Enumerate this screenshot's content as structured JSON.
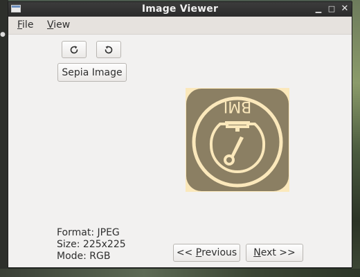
{
  "window": {
    "title": "Image Viewer"
  },
  "menu": {
    "file": {
      "mnemonic": "F",
      "rest": "ile"
    },
    "view": {
      "mnemonic": "V",
      "rest": "iew"
    }
  },
  "toolbar": {
    "sepia_label": "Sepia Image"
  },
  "image": {
    "logo_text": "BMI",
    "bg_color": "#8b7f63",
    "fg_color": "#fbe8bb"
  },
  "info": {
    "format": "Format: JPEG",
    "size": "Size: 225x225",
    "mode": "Mode: RGB"
  },
  "nav": {
    "prev_prefix": "<< ",
    "prev_mnemonic": "P",
    "prev_rest": "revious",
    "next_mnemonic": "N",
    "next_rest": "ext >>"
  },
  "icons": {
    "window": "app-window-icon",
    "minimize": "minimize-icon",
    "maximize": "maximize-icon",
    "close": "close-icon",
    "rotate_cw": "rotate-clockwise-icon",
    "rotate_ccw": "rotate-counterclockwise-icon"
  }
}
